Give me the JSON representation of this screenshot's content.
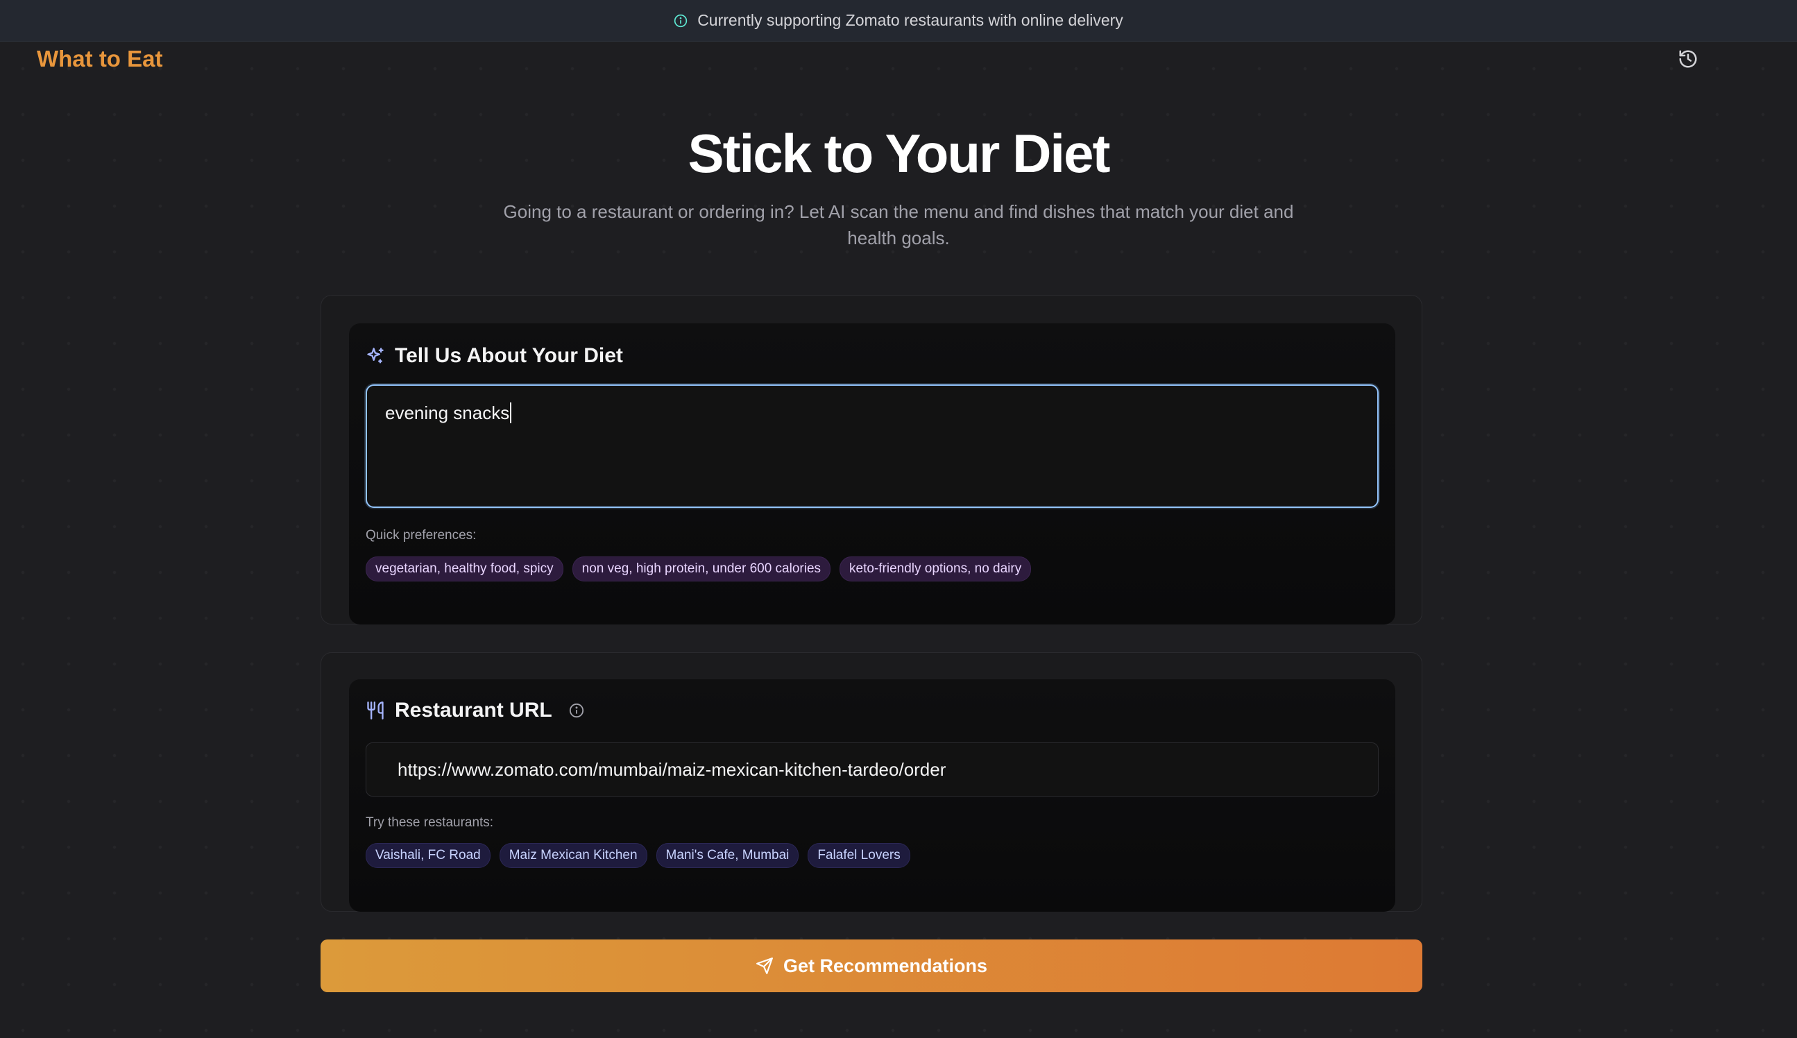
{
  "banner": {
    "icon": "info-icon",
    "text": "Currently supporting Zomato restaurants with online delivery"
  },
  "header": {
    "brand": "What to Eat",
    "history_icon": "history-icon"
  },
  "hero": {
    "title": "Stick to Your Diet",
    "subtitle": "Going to a restaurant or ordering in? Let AI scan the menu and find dishes that match your diet and health goals."
  },
  "diet_card": {
    "icon": "sparkles-icon",
    "title": "Tell Us About Your Diet",
    "input_value": "evening snacks",
    "quick_label": "Quick preferences:",
    "quick_chips": [
      "vegetarian, healthy food, spicy",
      "non veg, high protein, under 600 calories",
      "keto-friendly options, no dairy"
    ]
  },
  "restaurant_card": {
    "icon": "utensils-icon",
    "title": "Restaurant URL",
    "info_icon": "info-icon",
    "url_value": "https://www.zomato.com/mumbai/maiz-mexican-kitchen-tardeo/order",
    "try_label": "Try these restaurants:",
    "restaurant_chips": [
      "Vaishali, FC Road",
      "Maiz Mexican Kitchen",
      "Mani's Cafe, Mumbai",
      "Falafel Lovers"
    ]
  },
  "cta": {
    "icon": "send-icon",
    "label": "Get Recommendations"
  },
  "colors": {
    "brand": "#e8963c",
    "accent_blue": "#93c5fd",
    "cta_start": "#dc9a3a",
    "cta_end": "#dd7a34"
  }
}
